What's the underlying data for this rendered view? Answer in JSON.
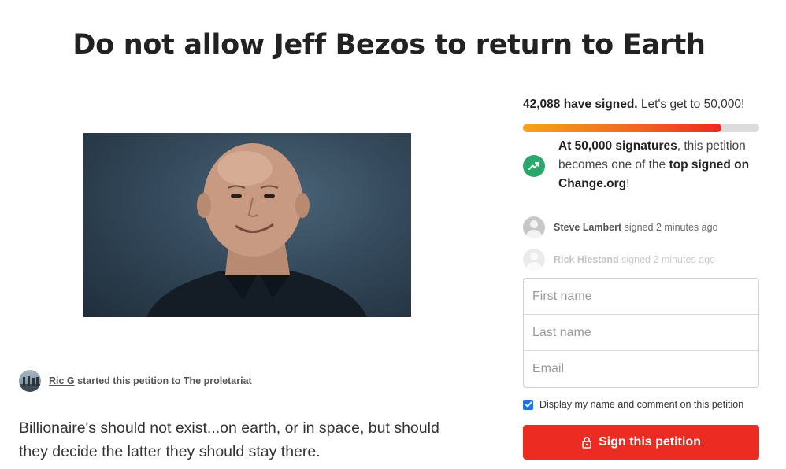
{
  "petition": {
    "title": "Do not allow Jeff Bezos to return to Earth",
    "starter": {
      "name": "Ric G",
      "action_text": "started this petition to",
      "recipient": "The proletariat"
    },
    "description": "Billionaire's should not exist...on earth, or in space, but should they decide the latter they should stay there."
  },
  "signatures": {
    "count": "42,088 have signed.",
    "goal_text": "Let's get to 50,000!",
    "progress_fraction": 0.84,
    "milestone": {
      "part1": "At 50,000 signatures",
      "part2": ", this petition becomes one of the ",
      "part3": "top signed on Change.org",
      "part4": "!"
    },
    "recent": [
      {
        "name": "Steve Lambert",
        "text": "signed 2 minutes ago"
      },
      {
        "name": "Rick Hiestand",
        "text": "signed 2 minutes ago"
      }
    ]
  },
  "form": {
    "first_name_placeholder": "First name",
    "last_name_placeholder": "Last name",
    "email_placeholder": "Email",
    "display_label": "Display my name and comment on this petition",
    "sign_label": "Sign this petition"
  },
  "colors": {
    "accent_red": "#ec2c22",
    "progress_start": "#f7a21b",
    "milestone_green": "#2aa86b",
    "checkbox_blue": "#1a73e8"
  },
  "icons": {
    "milestone": "trending-up-icon",
    "sign_button": "lock-icon",
    "checkbox": "checkmark-icon"
  }
}
